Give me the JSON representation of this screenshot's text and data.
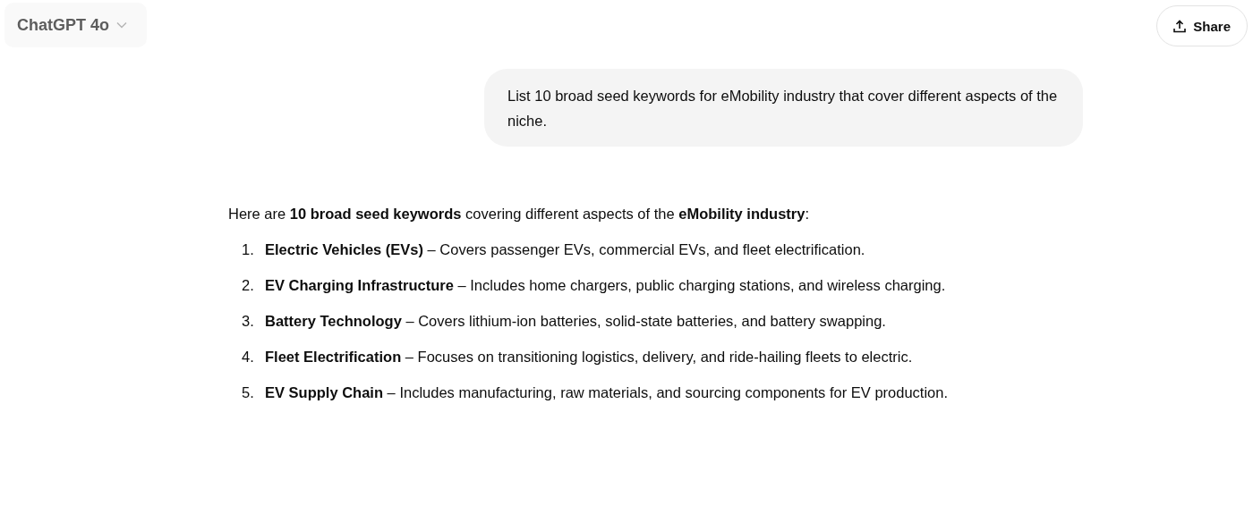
{
  "header": {
    "model": "ChatGPT 4o",
    "share": "Share"
  },
  "user_message": "List 10 broad seed keywords for eMobility industry that cover different aspects of the niche.",
  "response": {
    "intro": "Here are **10 broad seed keywords** covering different aspects of the **eMobility industry**:",
    "items": [
      {
        "number": "1.",
        "text": "**Electric Vehicles (EVs)** – Covers passenger EVs, commercial EVs, and fleet electrification."
      },
      {
        "number": "2.",
        "text": "**EV Charging Infrastructure** – Includes home chargers, public charging stations, and wireless charging."
      },
      {
        "number": "3.",
        "text": "**Battery Technology** – Covers lithium-ion batteries, solid-state batteries, and battery swapping."
      },
      {
        "number": "4.",
        "text": "**Fleet Electrification** – Focuses on transitioning logistics, delivery, and ride-hailing fleets to electric."
      },
      {
        "number": "5.",
        "text": "**EV Supply Chain** – Includes manufacturing, raw materials, and sourcing components for EV production."
      }
    ]
  }
}
